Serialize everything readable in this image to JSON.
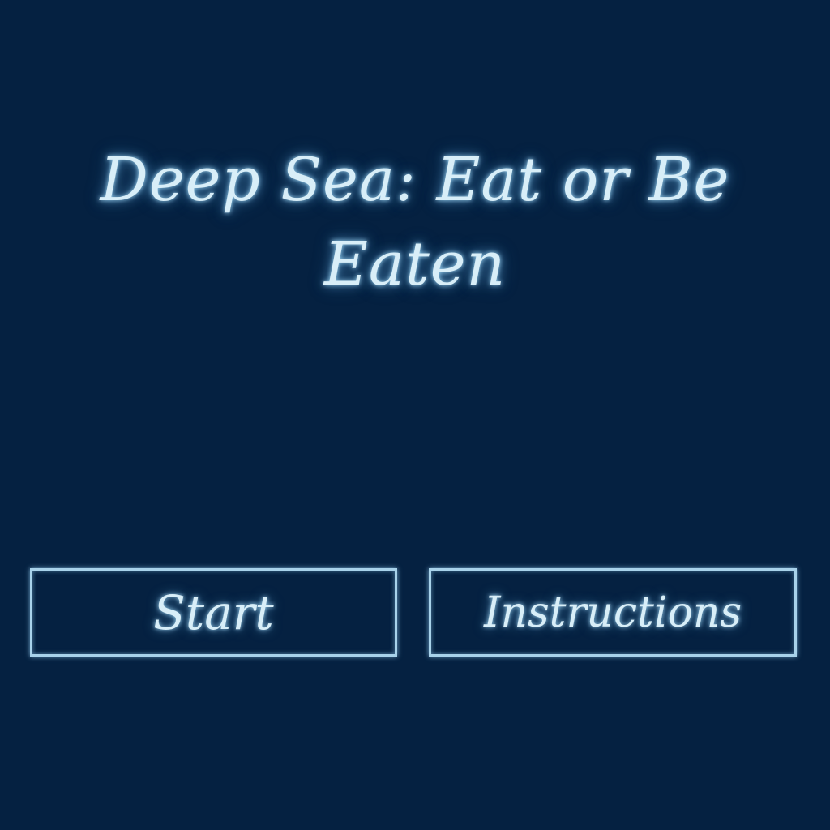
{
  "menu": {
    "title": "Deep Sea: Eat or Be Eaten",
    "start_label": "Start",
    "instructions_label": "Instructions"
  },
  "colors": {
    "background": "#052141",
    "text_glow": "#d8eef8",
    "button_border": "#a8d2ea"
  }
}
